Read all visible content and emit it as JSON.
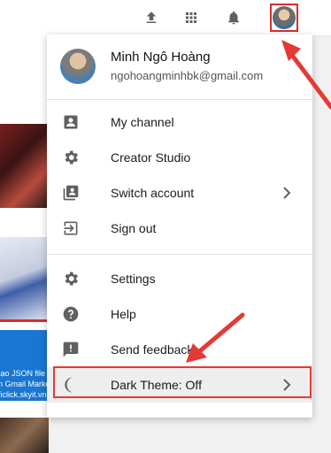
{
  "topbar": {
    "icons": [
      "upload-icon",
      "apps-grid-icon",
      "notifications-bell-icon"
    ],
    "avatar": "account-avatar"
  },
  "background": {
    "thumb_text_lines": [
      "tạo JSON file",
      "n Gmail Marke",
      "ficlick.skyit.vn"
    ]
  },
  "account": {
    "name": "Minh Ngô Hoàng",
    "email": "ngohoangminhbk@gmail.com"
  },
  "menu": {
    "section1": [
      {
        "label": "My channel",
        "icon": "person-icon"
      },
      {
        "label": "Creator Studio",
        "icon": "gear-icon"
      },
      {
        "label": "Switch account",
        "icon": "switch-account-icon",
        "chevron": true
      },
      {
        "label": "Sign out",
        "icon": "sign-out-icon"
      }
    ],
    "section2": [
      {
        "label": "Settings",
        "icon": "settings-icon"
      },
      {
        "label": "Help",
        "icon": "help-icon"
      },
      {
        "label": "Send feedback",
        "icon": "feedback-icon"
      },
      {
        "label": "Dark Theme: Off",
        "icon": "moon-icon",
        "chevron": true
      }
    ]
  },
  "colors": {
    "highlight": "#e53935",
    "icon_gray": "#606060"
  }
}
